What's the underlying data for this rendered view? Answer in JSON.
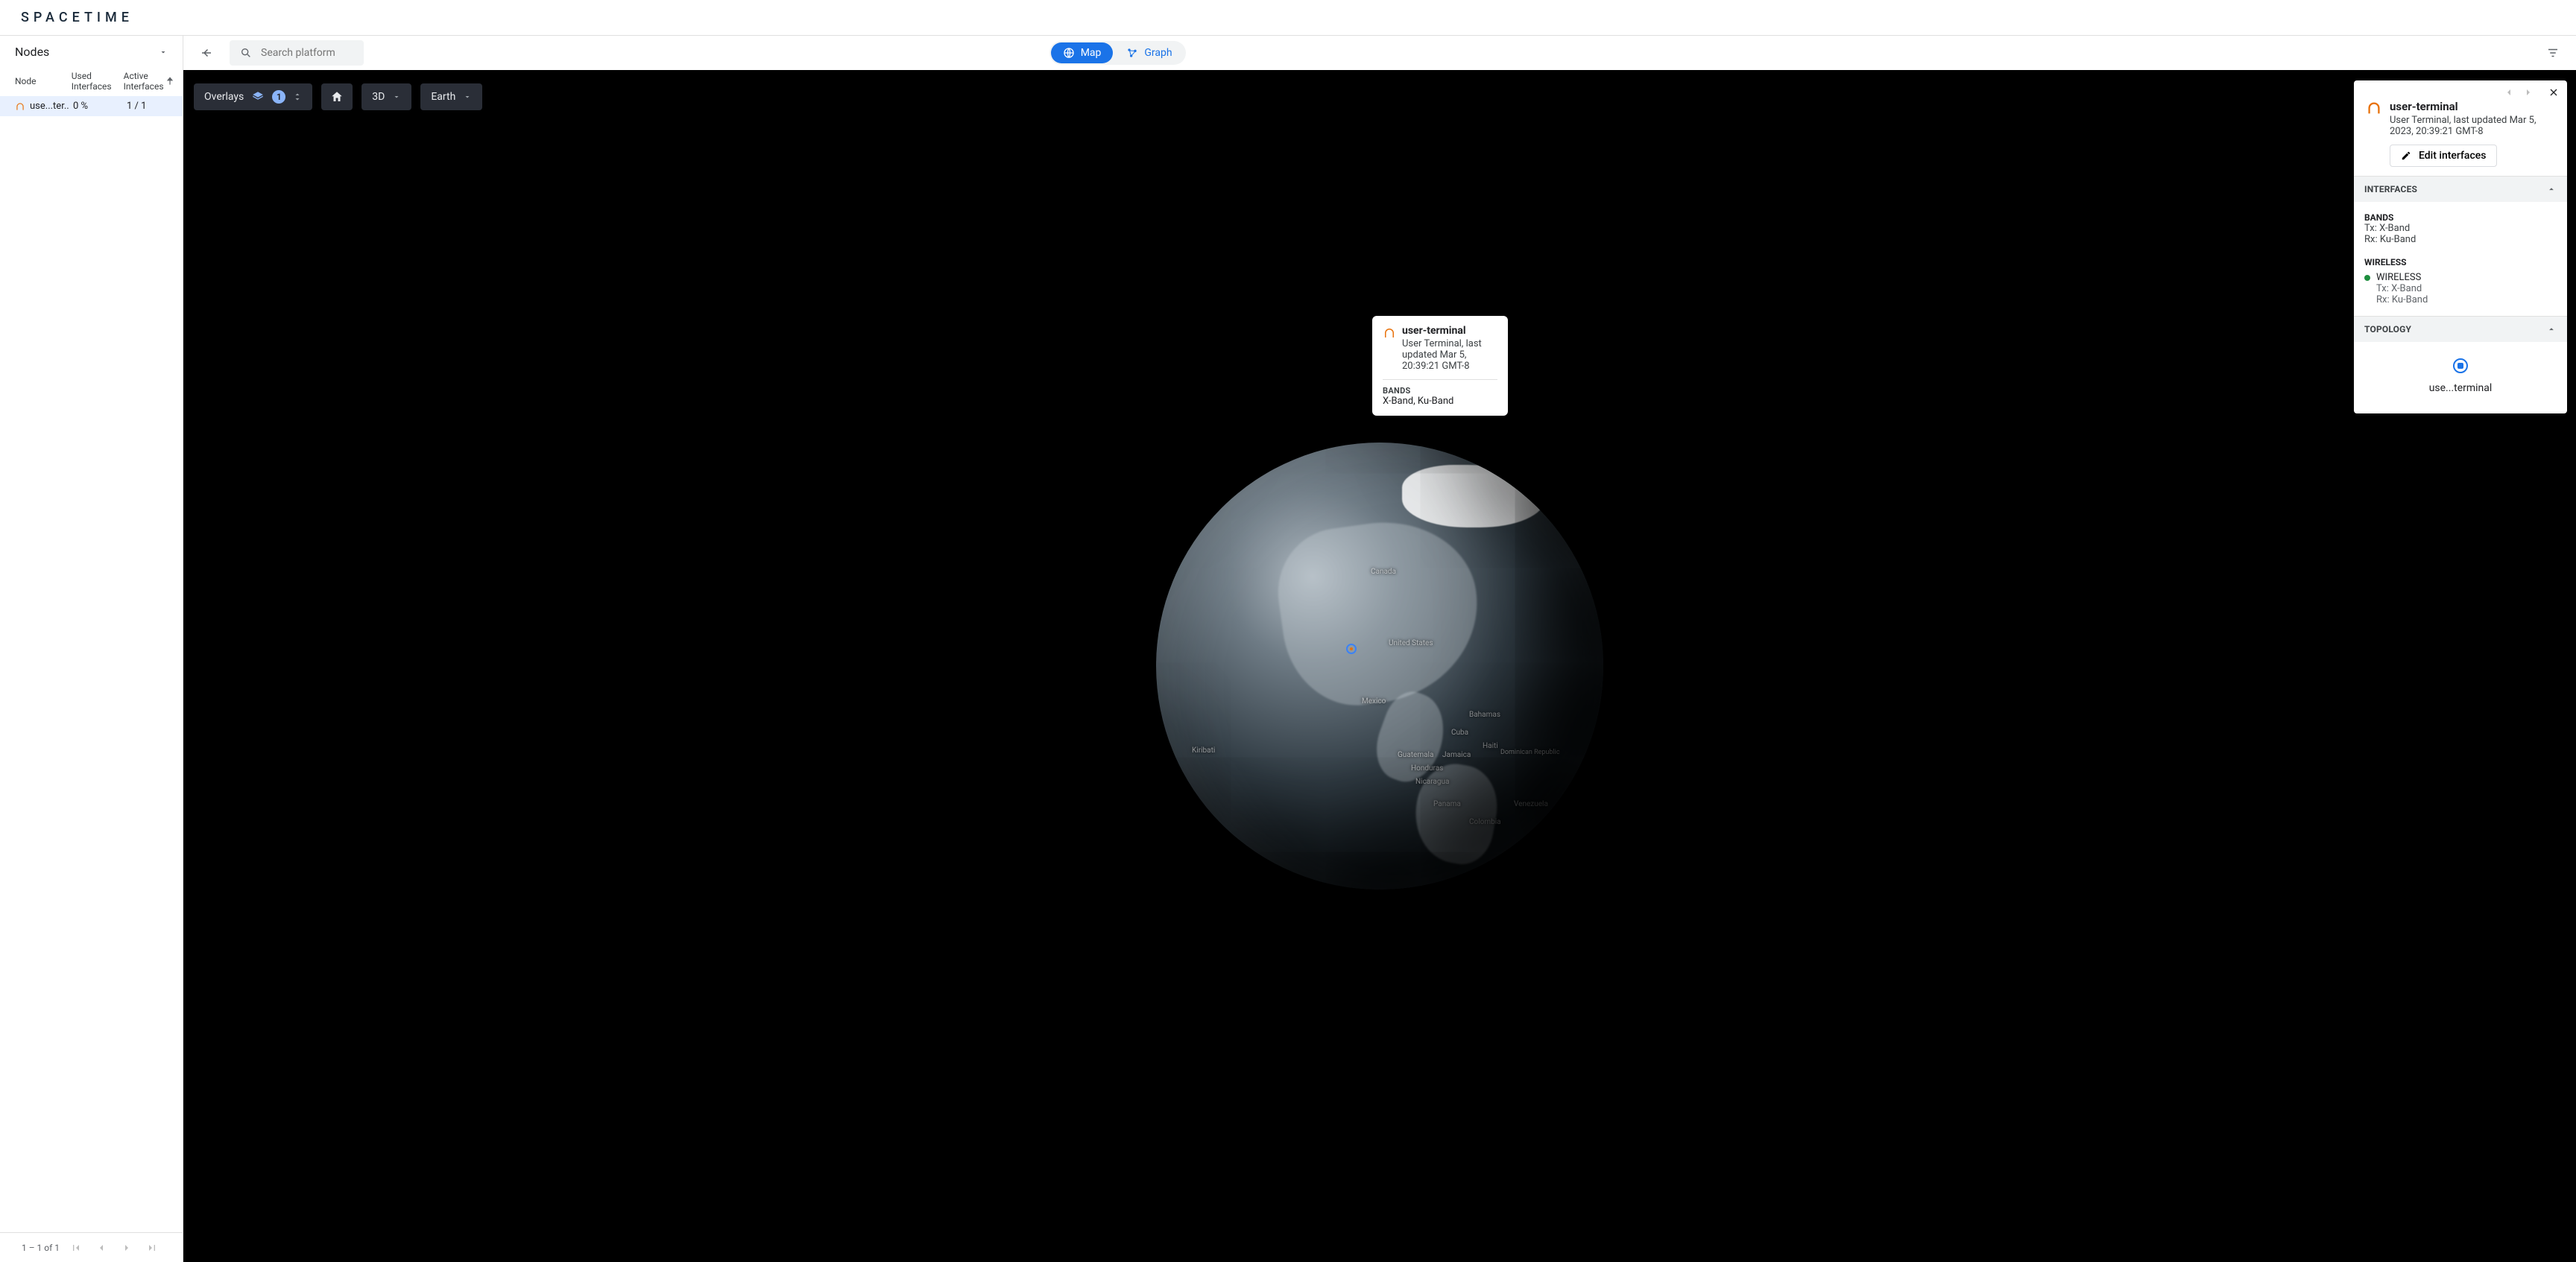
{
  "brand": "SPACETIME",
  "sidebar": {
    "selector_label": "Nodes",
    "columns": {
      "node": "Node",
      "used": "Used Interfaces",
      "active": "Active Interfaces"
    },
    "rows": [
      {
        "name": "use...ter..",
        "used": "0 %",
        "active": "1 / 1"
      }
    ],
    "pagination": "1 – 1 of 1"
  },
  "toolbar": {
    "search_placeholder": "Search platform",
    "tabs": {
      "map": "Map",
      "graph": "Graph"
    }
  },
  "map_controls": {
    "overlays_label": "Overlays",
    "overlays_count": "1",
    "view_mode": "3D",
    "base_layer": "Earth"
  },
  "globe_labels": {
    "canada": "Canada",
    "us": "United States",
    "mexico": "Mexico",
    "cuba": "Cuba",
    "bahamas": "Bahamas",
    "haiti": "Haiti",
    "dr": "Dominican Republic",
    "jamaica": "Jamaica",
    "guatemala": "Guatemala",
    "honduras": "Honduras",
    "nicaragua": "Nicaragua",
    "panama": "Panama",
    "colombia": "Colombia",
    "venezuela": "Venezuela",
    "kiribati": "Kiribati"
  },
  "map_tooltip": {
    "title": "user-terminal",
    "subtitle": "User Terminal, last updated Mar 5, 20:39:21 GMT-8",
    "bands_label": "BANDS",
    "bands_value": "X-Band, Ku-Band"
  },
  "right_panel": {
    "title": "user-terminal",
    "subtitle": "User Terminal, last updated Mar 5, 2023, 20:39:21 GMT-8",
    "edit_label": "Edit interfaces",
    "sections": {
      "interfaces": {
        "heading": "INTERFACES",
        "bands_heading": "BANDS",
        "tx": "Tx: X-Band",
        "rx": "Rx: Ku-Band",
        "wireless_heading": "WIRELESS",
        "wl_name": "WIRELESS",
        "wl_tx": "Tx: X-Band",
        "wl_rx": "Rx: Ku-Band"
      },
      "topology": {
        "heading": "TOPOLOGY",
        "node_label": "use...terminal"
      }
    }
  }
}
